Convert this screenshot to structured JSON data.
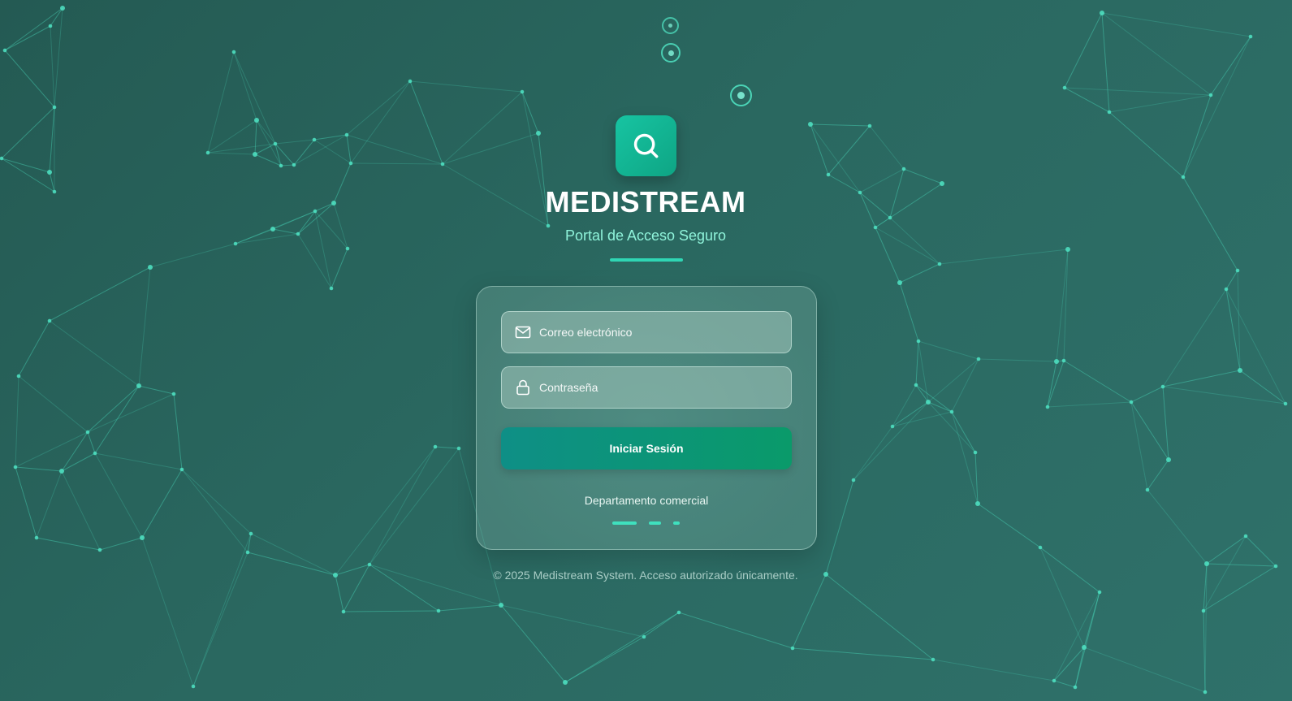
{
  "brand": {
    "title": "MEDISTREAM",
    "subtitle": "Portal de Acceso Seguro",
    "logo_icon": "search-icon"
  },
  "login_form": {
    "email": {
      "placeholder": "Correo electrónico",
      "value": "",
      "icon": "envelope-icon"
    },
    "password": {
      "placeholder": "Contraseña",
      "value": "",
      "icon": "lock-icon"
    },
    "submit_label": "Iniciar Sesión",
    "department": "Departamento comercial"
  },
  "footer": {
    "text": "© 2025 Medistream System. Acceso autorizado únicamente."
  },
  "colors": {
    "background_dark": "#245a53",
    "background_light": "#2f716a",
    "accent": "#2fd6b4",
    "node": "#4fe3c3",
    "button_start": "#0e8f86",
    "button_end": "#0a9a6a"
  }
}
